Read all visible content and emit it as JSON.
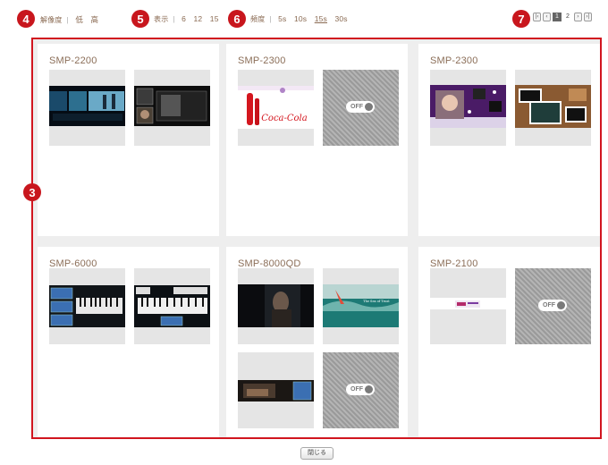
{
  "toolbar": {
    "resolution": {
      "callout": "4",
      "label": "解像度",
      "options": [
        "低",
        "高"
      ]
    },
    "display": {
      "callout": "5",
      "label": "表示",
      "options": [
        "6",
        "12",
        "15"
      ]
    },
    "interval": {
      "callout": "6",
      "label": "頻度",
      "options": [
        "5s",
        "10s",
        "15s",
        "30s"
      ],
      "selected": "15s"
    },
    "pager": {
      "callout": "7",
      "first_glyph": "|‹",
      "prev_glyph": "‹",
      "pages": [
        "1",
        "2"
      ],
      "current": "1",
      "next_glyph": "›",
      "last_glyph": "›|"
    }
  },
  "grid": {
    "callout": "3",
    "cards": [
      {
        "title": "SMP-2200",
        "thumbs": [
          "screen",
          "screen"
        ]
      },
      {
        "title": "SMP-2300",
        "thumbs": [
          "screen",
          "off"
        ]
      },
      {
        "title": "SMP-2300",
        "thumbs": [
          "screen",
          "screen"
        ]
      },
      {
        "title": "SMP-6000",
        "thumbs": [
          "screen",
          "screen"
        ]
      },
      {
        "title": "SMP-8000QD",
        "thumbs": [
          "screen",
          "screen",
          "screen",
          "off"
        ]
      },
      {
        "title": "SMP-2100",
        "thumbs": [
          "screen",
          "off"
        ]
      }
    ],
    "off_label": "OFF",
    "screen_texts": {
      "cocacola": "Coca-Cola",
      "sea_title": "The Sea of Trust"
    }
  },
  "close_label": "閉じる"
}
